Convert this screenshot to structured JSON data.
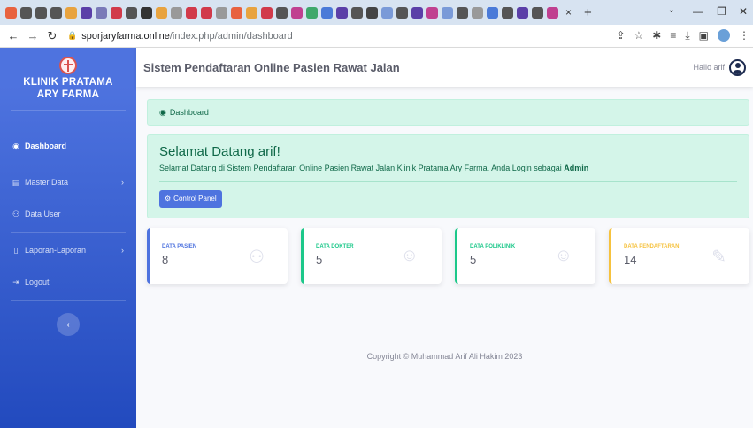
{
  "browser": {
    "tab_close": "×",
    "new_tab": "+",
    "url_host": "sporjaryfarma.online",
    "url_path": "/index.php/admin/dashboard",
    "win_minimize": "—",
    "win_maximize": "❐",
    "win_close": "✕"
  },
  "sidebar": {
    "brand_line1": "KLINIK PRATAMA",
    "brand_line2": "ARY FARMA",
    "items": [
      {
        "label": "Dashboard",
        "icon": "tachometer-icon"
      },
      {
        "label": "Master Data",
        "icon": "folder-icon"
      },
      {
        "label": "Data User",
        "icon": "users-icon"
      },
      {
        "label": "Laporan-Laporan",
        "icon": "file-icon"
      },
      {
        "label": "Logout",
        "icon": "logout-icon"
      }
    ],
    "toggle": "‹"
  },
  "topbar": {
    "title": "Sistem Pendaftaran Online Pasien Rawat Jalan",
    "greeting": "Hallo arif"
  },
  "breadcrumb": {
    "label": "Dashboard"
  },
  "welcome": {
    "heading": "Selamat Datang arif!",
    "message": "Selamat Datang di Sistem Pendaftaran Online Pasien Rawat Jalan Klinik Pratama Ary Farma. Anda Login sebagai ",
    "role": "Admin",
    "button": "Control Panel"
  },
  "cards": [
    {
      "label": "DATA PASIEN",
      "value": "8",
      "color": "#4e73df",
      "icon": "users-icon"
    },
    {
      "label": "DATA DOKTER",
      "value": "5",
      "color": "#1cc88a",
      "icon": "user-icon"
    },
    {
      "label": "DATA POLIKLINIK",
      "value": "5",
      "color": "#1cc88a",
      "icon": "user-icon"
    },
    {
      "label": "DATA PENDAFTARAN",
      "value": "14",
      "color": "#f6c23e",
      "icon": "edit-icon"
    }
  ],
  "footer": {
    "copyright": "Copyright © Muhammad Arif Ali Hakim 2023"
  },
  "colors": {
    "primary": "#4e73df",
    "success": "#1cc88a",
    "warning": "#f6c23e",
    "alert_bg": "#d4f5e9"
  }
}
